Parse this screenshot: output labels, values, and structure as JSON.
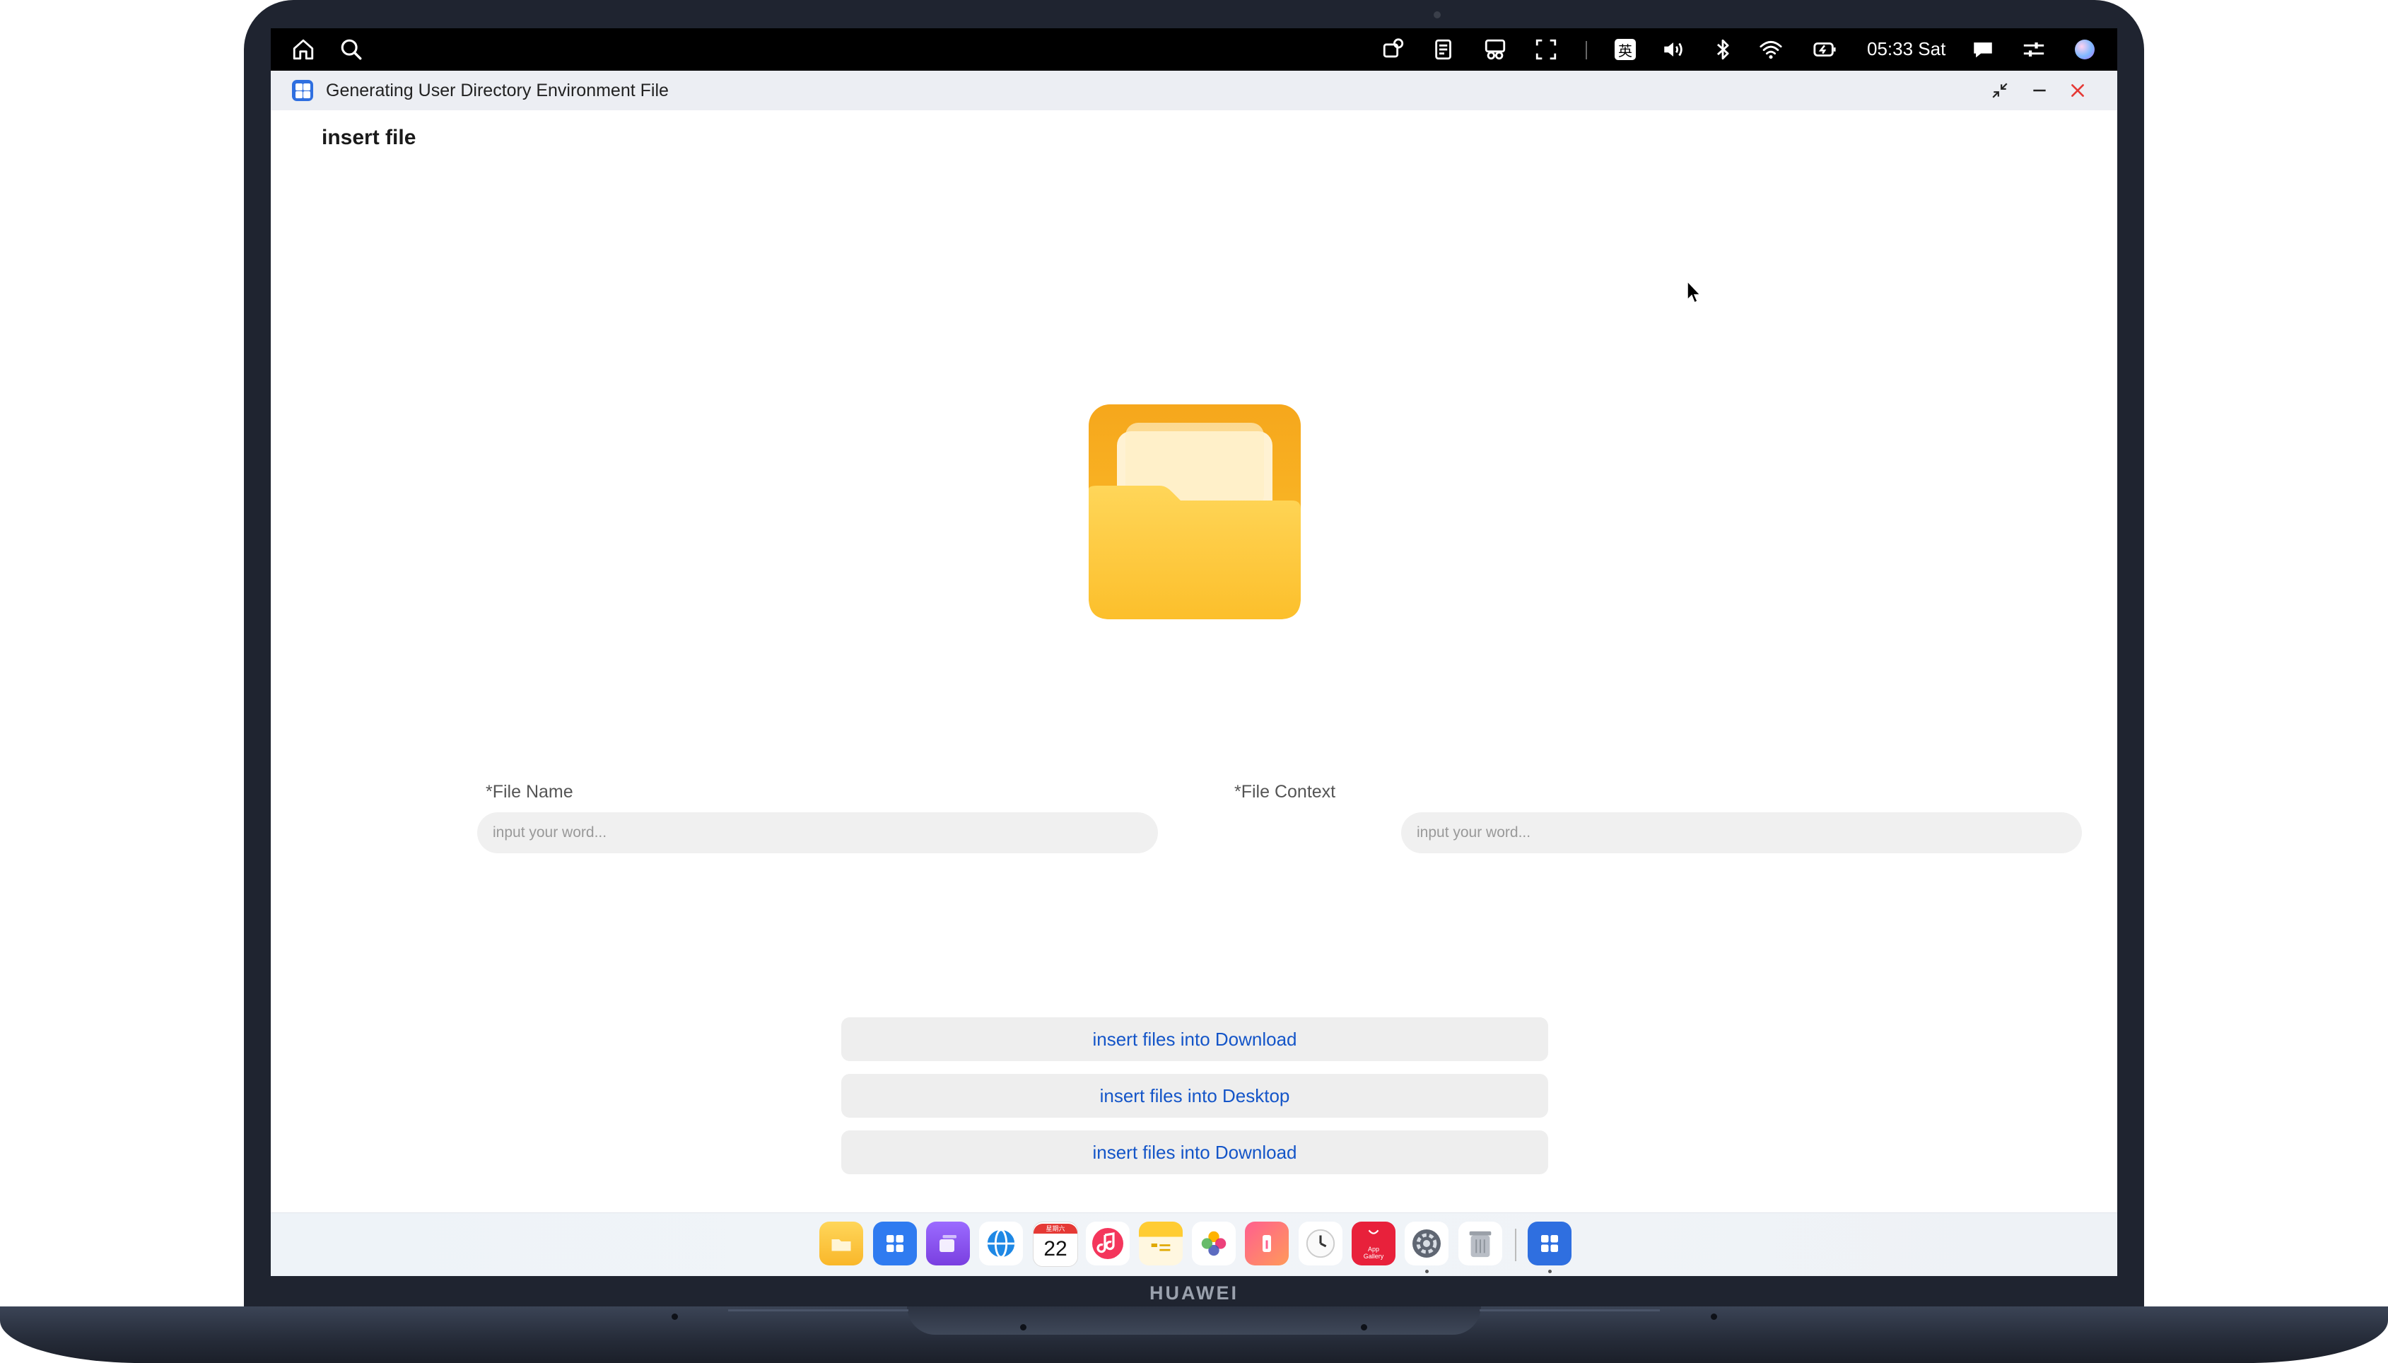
{
  "status_bar": {
    "time": "05:33 Sat",
    "ime_label": "英",
    "icons": [
      "home-icon",
      "search-icon",
      "screenshot-icon",
      "notes-icon",
      "scissors-icon",
      "scan-icon",
      "ime-icon",
      "volume-icon",
      "bluetooth-icon",
      "wifi-icon",
      "battery-icon",
      "chat-icon",
      "controls-icon",
      "assistant-icon"
    ]
  },
  "window": {
    "title": "Generating User Directory Environment File",
    "controls": [
      "restore-icon",
      "minimize-icon",
      "close-icon"
    ]
  },
  "page": {
    "heading": "insert file",
    "icon": "folder-icon"
  },
  "form": {
    "file_name_label": "*File Name",
    "file_name_placeholder": "input your word...",
    "file_context_label": "*File Context",
    "file_context_placeholder": "input your word..."
  },
  "actions": [
    {
      "label": "insert files into Download"
    },
    {
      "label": "insert files into Desktop"
    },
    {
      "label": "insert files into Download"
    }
  ],
  "dock": {
    "calendar_day": "22",
    "calendar_weekday": "星期六",
    "appgallery_label": "App Gallery",
    "apps": [
      "files",
      "app-launcher",
      "multitask",
      "browser",
      "calendar",
      "music",
      "notepad",
      "photos",
      "tips",
      "clock",
      "appgallery",
      "settings",
      "trash",
      "running-app"
    ]
  },
  "device_brand": "HUAWEI",
  "colors": {
    "accent": "#1455c8",
    "folder": "#f9b72a",
    "close": "#e53935"
  }
}
